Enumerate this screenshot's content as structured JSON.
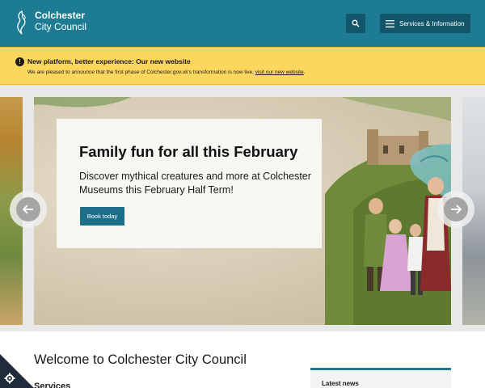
{
  "header": {
    "logo_line1": "Colchester",
    "logo_line2": "City Council",
    "search_icon": "search-icon",
    "menu_label": "Services & Information",
    "menu_icon": "hamburger-icon",
    "color": "#1d7c93"
  },
  "alert": {
    "icon": "exclamation-icon",
    "title": "New platform, better experience: Our new website",
    "body": "We are pleased to announce that the first phase of Colchester.gov.uk's transformation is now live,",
    "link": "visit our new website",
    "body_end": ".",
    "color": "#fcd75e"
  },
  "carousel": {
    "slide": {
      "title": "Family fun for all this February",
      "text": "Discover mythical creatures and more at Colchester Museums this February Half Term!",
      "button": "Book today"
    },
    "prev_icon": "arrow-left-icon",
    "next_icon": "arrow-right-icon"
  },
  "main": {
    "welcome": "Welcome to Colchester City Council",
    "services_heading": "Services",
    "news_heading": "Latest news"
  },
  "cookie": {
    "icon": "gear-icon"
  }
}
